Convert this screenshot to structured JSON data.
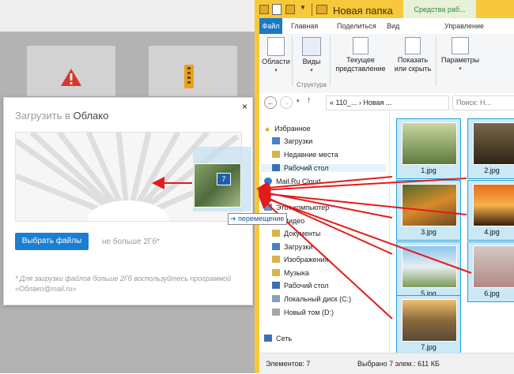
{
  "explorer": {
    "title": "Новая папка",
    "tools_tab": "Средства раб...",
    "tabs": [
      "Файл",
      "Главная",
      "Поделиться",
      "Вид",
      "Управление"
    ],
    "ribbon": {
      "areas": "Области",
      "views": "Виды",
      "current_view": "Текущее представление",
      "show_hide": "Показать или скрыть",
      "parameters": "Параметры",
      "group_structure": "Структура"
    },
    "address": "« 110_... › Новая ...",
    "search_placeholder": "Поиск: Н...",
    "nav": {
      "favorites": "Избранное",
      "downloads": "Загрузки",
      "recent": "Недавние места",
      "desktop": "Рабочий стол",
      "mailru_cloud": "Mail.Ru Cloud",
      "this_pc": "Этот компьютер",
      "video": "Видео",
      "documents": "Документы",
      "downloads2": "Загрузки",
      "images": "Изображения",
      "music": "Музыка",
      "desktop2": "Рабочий стол",
      "local_disk": "Локальный диск (C:)",
      "new_volume": "Новый том (D:)",
      "network": "Сеть"
    },
    "files": [
      {
        "name": "1.jpg"
      },
      {
        "name": "2.jpg"
      },
      {
        "name": "3.jpg"
      },
      {
        "name": "4.jpg"
      },
      {
        "name": "5.jpg"
      },
      {
        "name": "6.jpg"
      },
      {
        "name": "7.jpg"
      }
    ],
    "status": {
      "items": "Элементов: 7",
      "selected": "Выбрано 7 элем.: 611 КБ"
    }
  },
  "upload": {
    "title_prefix": "Загрузить в ",
    "title_target": "Облако",
    "close": "×",
    "select_button": "Выбрать файлы",
    "size_limit": "не больше 2Гб*",
    "footnote": "* Для загрузки файлов больше 2Гб воспользуйтесь программой «Облако@mail.ru»"
  },
  "drag": {
    "count_badge": "7",
    "tooltip": "перемещение"
  },
  "colors": {
    "accent_blue": "#1a7fd2",
    "explorer_title": "#f7c83c",
    "arrow_red": "#e21b1b",
    "selection": "#cbe8f6"
  }
}
